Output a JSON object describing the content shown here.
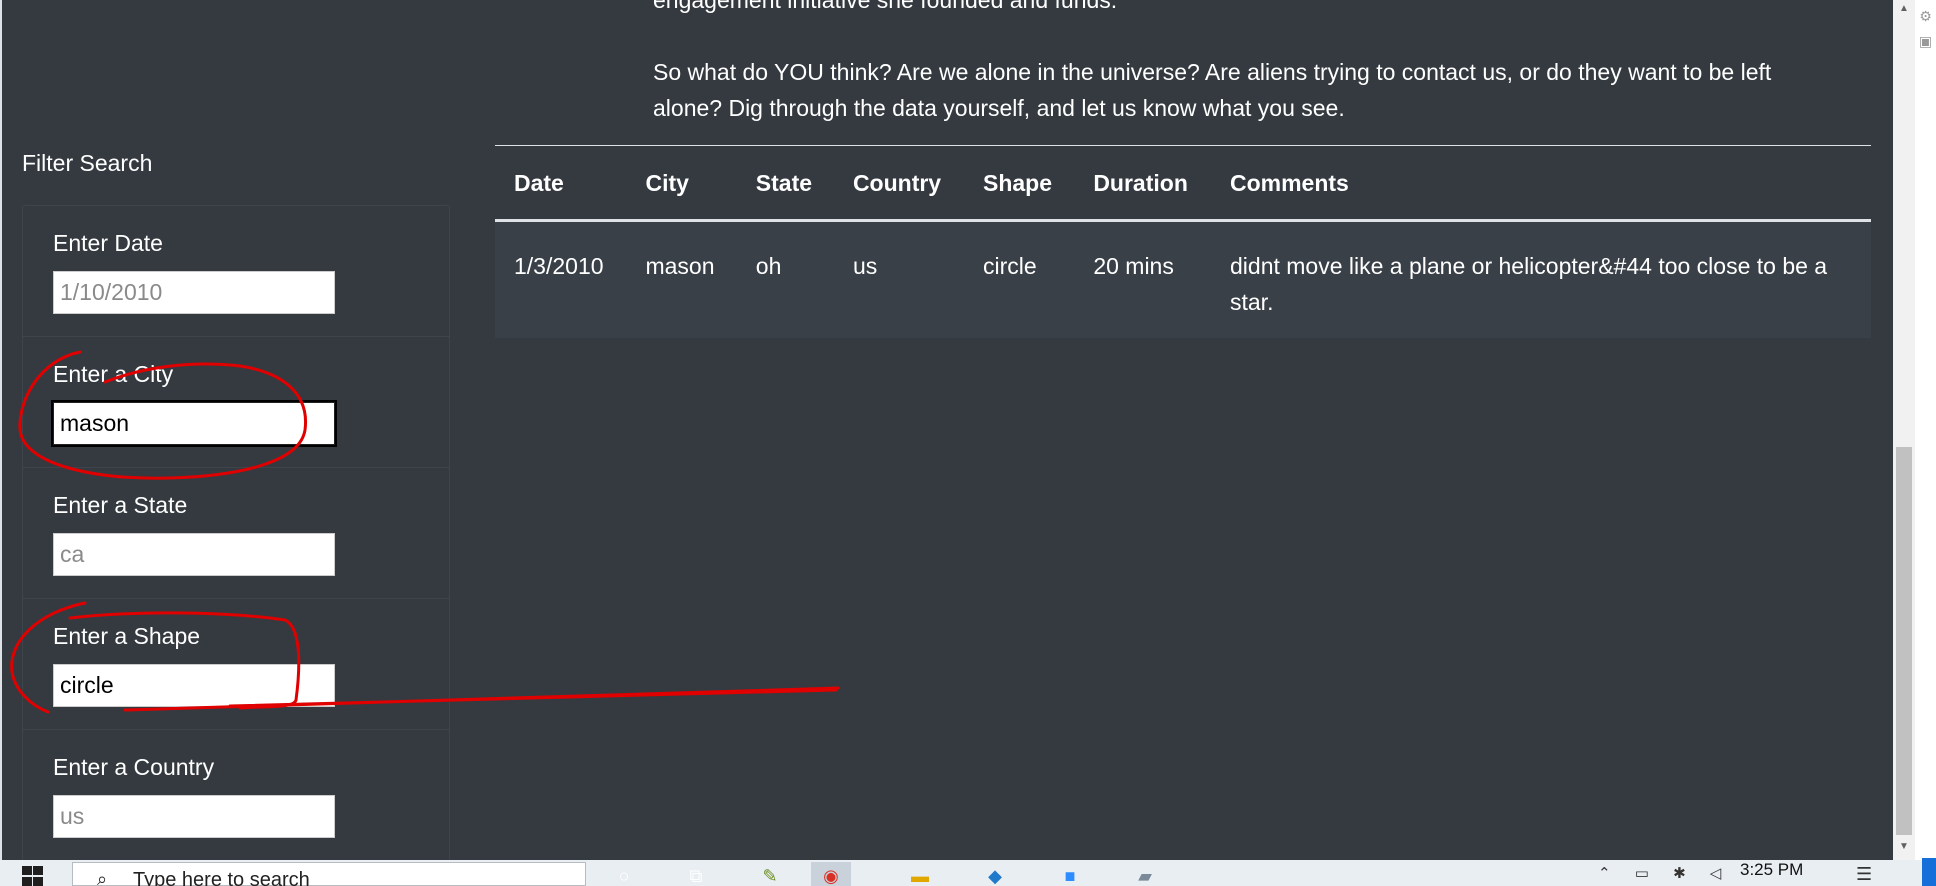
{
  "intro": {
    "line_top": "engagement initiative she founded and funds.",
    "paragraph": "So what do YOU think? Are we alone in the universe? Are aliens trying to contact us, or do they want to be left alone? Dig through the data yourself, and let us know what you see."
  },
  "filter": {
    "title": "Filter Search",
    "fields": [
      {
        "label": "Enter Date",
        "placeholder": "1/10/2010",
        "value": ""
      },
      {
        "label": "Enter a City",
        "placeholder": "",
        "value": "mason"
      },
      {
        "label": "Enter a State",
        "placeholder": "ca",
        "value": ""
      },
      {
        "label": "Enter a Shape",
        "placeholder": "",
        "value": "circle"
      },
      {
        "label": "Enter a Country",
        "placeholder": "us",
        "value": ""
      }
    ]
  },
  "table": {
    "headers": [
      "Date",
      "City",
      "State",
      "Country",
      "Shape",
      "Duration",
      "Comments"
    ],
    "rows": [
      [
        "1/3/2010",
        "mason",
        "oh",
        "us",
        "circle",
        "20 mins",
        "didnt move like a plane or helicopter&#44 too close to be a star."
      ]
    ]
  },
  "taskbar": {
    "search_placeholder": "Type here to search",
    "time": "3:25 PM"
  },
  "colors": {
    "background": "#343a40",
    "annotation": "#e00000",
    "taskbar": "#e9eef3"
  }
}
